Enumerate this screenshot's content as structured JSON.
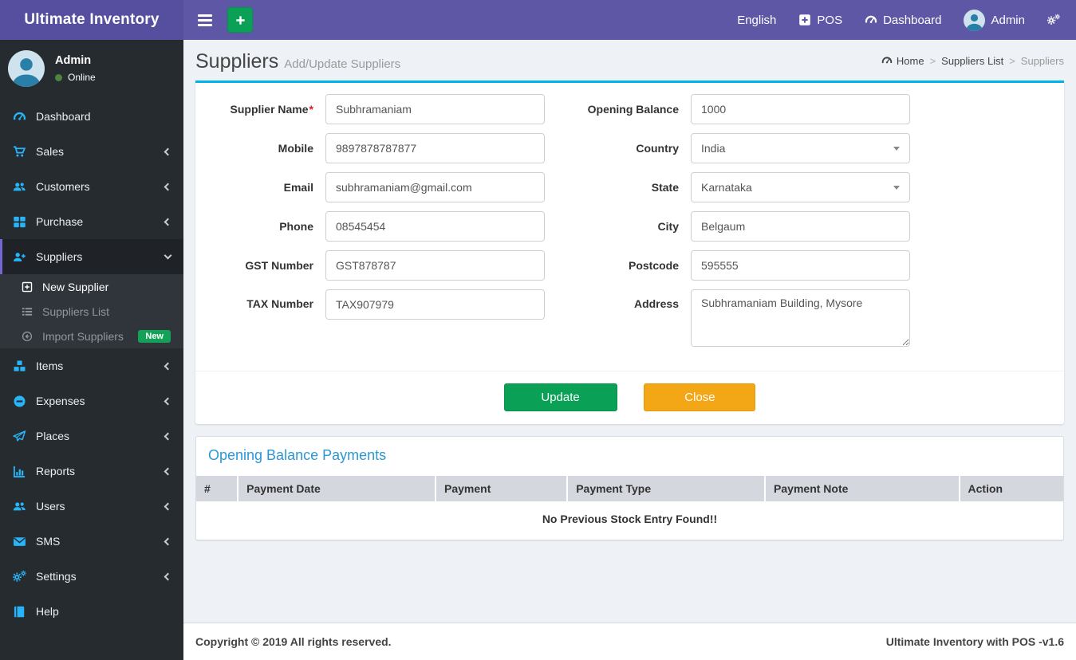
{
  "colors": {
    "navbar_purple": "#5e57a6",
    "brand_purple": "#564fa0",
    "sidebar_dark": "#262b2f",
    "submenu_dark": "#2f353b",
    "active_border_purple": "#7667d0",
    "icon_blue": "#28b5f7",
    "panel_accent_cyan": "#00b3e6",
    "button_green": "#0aa157",
    "button_orange": "#f4a716",
    "badge_green": "#12a156",
    "heading_blue": "#2b97d3",
    "online_green": "#4e8341",
    "table_header_gray": "#d4d7de"
  },
  "navbar": {
    "brand": "Ultimate Inventory",
    "menu_icon": "hamburger-icon",
    "add_icon": "plus-icon",
    "language": "English",
    "pos": "POS",
    "pos_icon": "plus-square-icon",
    "dashboard": "Dashboard",
    "dashboard_icon": "gauge-icon",
    "user": "Admin",
    "user_icon": "avatar-person-icon",
    "settings_icon": "cogs-icon"
  },
  "sidebar": {
    "user": {
      "name": "Admin",
      "status": "Online"
    },
    "items": [
      {
        "label": "Dashboard",
        "icon": "gauge-icon"
      },
      {
        "label": "Sales",
        "icon": "cart-icon"
      },
      {
        "label": "Customers",
        "icon": "users-icon"
      },
      {
        "label": "Purchase",
        "icon": "grid-icon"
      },
      {
        "label": "Suppliers",
        "icon": "user-plus-icon"
      },
      {
        "label": "Items",
        "icon": "cubes-icon"
      },
      {
        "label": "Expenses",
        "icon": "minus-circle-icon"
      },
      {
        "label": "Places",
        "icon": "paper-plane-icon"
      },
      {
        "label": "Reports",
        "icon": "bar-chart-icon"
      },
      {
        "label": "Users",
        "icon": "users-icon"
      },
      {
        "label": "SMS",
        "icon": "envelope-icon"
      },
      {
        "label": "Settings",
        "icon": "cogs-icon"
      },
      {
        "label": "Help",
        "icon": "book-icon"
      }
    ],
    "suppliers_submenu": [
      {
        "label": "New Supplier",
        "icon": "plus-square-outline-icon"
      },
      {
        "label": "Suppliers List",
        "icon": "list-icon"
      },
      {
        "label": "Import Suppliers",
        "icon": "arrow-circle-left-icon",
        "badge": "New"
      }
    ]
  },
  "page": {
    "title": "Suppliers",
    "subtitle": "Add/Update Suppliers",
    "breadcrumb": [
      "Home",
      "Suppliers List",
      "Suppliers"
    ]
  },
  "form": {
    "required_mark": "*",
    "rows": [
      {
        "left_label": "Supplier Name",
        "left_value": "Subhramaniam",
        "right_label": "Opening Balance",
        "right_value": "1000"
      },
      {
        "left_label": "Mobile",
        "left_value": "9897878787877",
        "right_label": "Country",
        "right_value": "India"
      },
      {
        "left_label": "Email",
        "left_value": "subhramaniam@gmail.com",
        "right_label": "State",
        "right_value": "Karnataka"
      },
      {
        "left_label": "Phone",
        "left_value": "08545454",
        "right_label": "City",
        "right_value": "Belgaum"
      },
      {
        "left_label": "GST Number",
        "left_value": "GST878787",
        "right_label": "Postcode",
        "right_value": "595555"
      },
      {
        "left_label": "TAX Number",
        "left_value": "TAX907979",
        "right_label": "Address",
        "right_value": "Subhramaniam Building, Mysore"
      }
    ],
    "buttons": {
      "update": "Update",
      "close": "Close"
    }
  },
  "payments": {
    "title": "Opening Balance Payments",
    "columns": [
      "#",
      "Payment Date",
      "Payment",
      "Payment Type",
      "Payment Note",
      "Action"
    ],
    "empty_message": "No Previous Stock Entry Found!!"
  },
  "footer": {
    "copyright": "Copyright © 2019 All rights reserved.",
    "version": "Ultimate Inventory with POS -v1.6"
  }
}
